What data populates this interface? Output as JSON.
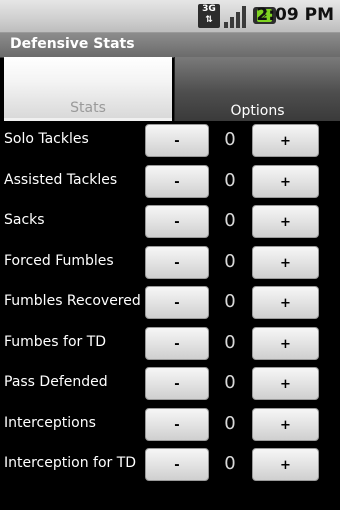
{
  "status_bar": {
    "network_badge": "3G",
    "network_arrows": "⇅",
    "battery_glyph": "⚡",
    "time": "2:09 PM",
    "icons": [
      "network-3g-icon",
      "signal-icon",
      "battery-charging-icon"
    ]
  },
  "app": {
    "title": "Defensive Stats"
  },
  "tabs": [
    {
      "label": "Stats",
      "selected": true
    },
    {
      "label": "Options",
      "selected": false
    }
  ],
  "buttons": {
    "minus": "-",
    "plus": "+"
  },
  "stats": [
    {
      "label": "Solo Tackles",
      "count": "0"
    },
    {
      "label": "Assisted Tackles",
      "count": "0"
    },
    {
      "label": "Sacks",
      "count": "0"
    },
    {
      "label": "Forced Fumbles",
      "count": "0"
    },
    {
      "label": "Fumbles Recovered",
      "count": "0"
    },
    {
      "label": "Fumbes for TD",
      "count": "0"
    },
    {
      "label": "Pass Defended",
      "count": "0"
    },
    {
      "label": "Interceptions",
      "count": "0"
    },
    {
      "label": "Interception for TD",
      "count": "0"
    }
  ]
}
